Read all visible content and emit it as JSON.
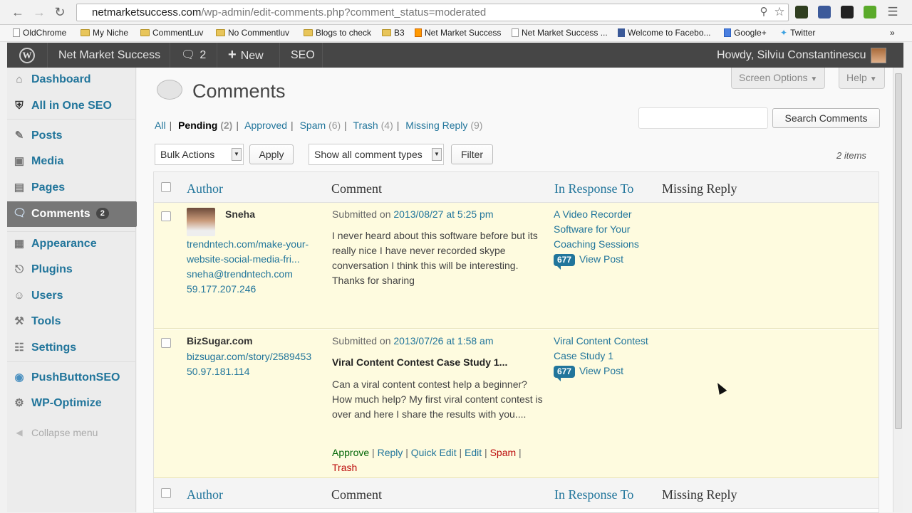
{
  "browser": {
    "url_domain": "netmarketsuccess.com",
    "url_path": "/wp-admin/edit-comments.php?comment_status=moderated",
    "bookmarks": [
      "OldChrome",
      "My Niche",
      "CommentLuv",
      "No Commentluv",
      "Blogs to check",
      "B3",
      "Net Market Success",
      "Net Market Success ...",
      "Welcome to Facebo...",
      "Google+",
      "Twitter"
    ],
    "more": "»"
  },
  "adminbar": {
    "site_name": "Net Market Success",
    "comments_count": "2",
    "new_label": "New",
    "seo_label": "SEO",
    "howdy": "Howdy, Silviu Constantinescu"
  },
  "sidebar": {
    "items": [
      {
        "label": "Dashboard"
      },
      {
        "label": "All in One SEO"
      },
      {
        "label": "Posts"
      },
      {
        "label": "Media"
      },
      {
        "label": "Pages"
      },
      {
        "label": "Comments",
        "badge": "2"
      },
      {
        "label": "Appearance"
      },
      {
        "label": "Plugins"
      },
      {
        "label": "Users"
      },
      {
        "label": "Tools"
      },
      {
        "label": "Settings"
      },
      {
        "label": "PushButtonSEO"
      },
      {
        "label": "WP-Optimize"
      }
    ],
    "collapse": "Collapse menu"
  },
  "page": {
    "title": "Comments",
    "screen_options": "Screen Options",
    "help": "Help",
    "search_button": "Search Comments",
    "filters": {
      "all": "All",
      "pending": "Pending",
      "pending_count": "(2)",
      "approved": "Approved",
      "spam": "Spam",
      "spam_count": "(6)",
      "trash": "Trash",
      "trash_count": "(4)",
      "missing": "Missing Reply",
      "missing_count": "(9)"
    },
    "bulk_actions": "Bulk Actions",
    "apply": "Apply",
    "comment_types": "Show all comment types",
    "filter": "Filter",
    "items_count": "2 items"
  },
  "table": {
    "headers": {
      "author": "Author",
      "comment": "Comment",
      "response": "In Response To",
      "missing": "Missing Reply"
    },
    "rows": [
      {
        "author": "Sneha",
        "url": "trendntech.com/make-your-",
        "url2": "website-social-media-fri...",
        "email": "sneha@trendntech.com",
        "ip": "59.177.207.246",
        "submitted": "Submitted on",
        "date": "2013/08/27 at 5:25 pm",
        "text": "I never heard about this software before but its really nice I have never recorded skype conversation I think this will be interesting. Thanks for sharing",
        "post_title": "A Video Recorder Software for Your Coaching Sessions",
        "post_count": "677",
        "view_post": "View Post"
      },
      {
        "author": "BizSugar.com",
        "url": "bizsugar.com/story/2589453",
        "ip": "50.97.181.114",
        "submitted": "Submitted on",
        "date": "2013/07/26 at 1:58 am",
        "heading": "Viral Content Contest Case Study 1...",
        "text": "Can a viral content contest help a beginner? How much help? My first viral content contest is over and here I share the results with you....",
        "post_title": "Viral Content Contest Case Study 1",
        "post_count": "677",
        "view_post": "View Post",
        "actions": {
          "approve": "Approve",
          "reply": "Reply",
          "quick_edit": "Quick Edit",
          "edit": "Edit",
          "spam": "Spam",
          "trash": "Trash"
        }
      }
    ]
  },
  "colors": {
    "link": "#21759b",
    "pending_row": "#fefbdf",
    "approve": "#006505",
    "spam": "#bc0b0b",
    "adminbar": "#464646"
  }
}
